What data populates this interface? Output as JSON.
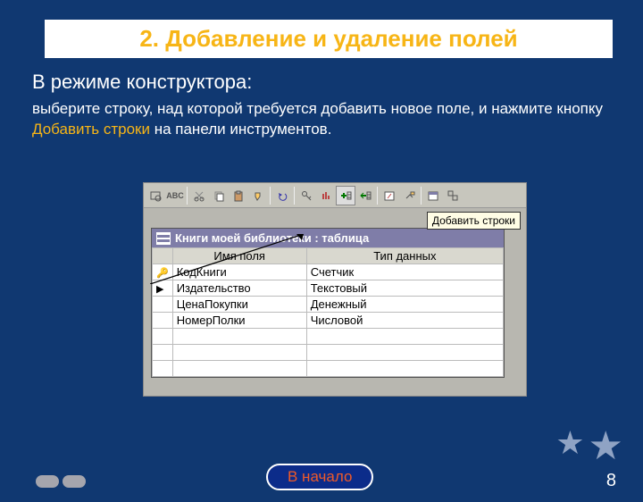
{
  "title": "2. Добавление и удаление полей",
  "subtitle": "В режиме конструктора:",
  "body_pre": "выберите строку, над которой требуется добавить новое поле, и нажмите кнопку ",
  "body_hl": "Добавить строки",
  "body_post": " на панели инструментов.",
  "tooltip": "Добавить строки",
  "window_title": "Книги моей библиотеки : таблица",
  "columns": {
    "name": "Имя поля",
    "type": "Тип данных"
  },
  "rows": [
    {
      "sel": "key",
      "name": "КодКниги",
      "type": "Счетчик"
    },
    {
      "sel": "cursor",
      "name": "Издательство",
      "type": "Текстовый"
    },
    {
      "sel": "",
      "name": "ЦенаПокупки",
      "type": "Денежный"
    },
    {
      "sel": "",
      "name": "НомерПолки",
      "type": "Числовой"
    },
    {
      "sel": "",
      "name": "",
      "type": ""
    },
    {
      "sel": "",
      "name": "",
      "type": ""
    },
    {
      "sel": "",
      "name": "",
      "type": ""
    }
  ],
  "home_button": "В начало",
  "page_number": "8"
}
